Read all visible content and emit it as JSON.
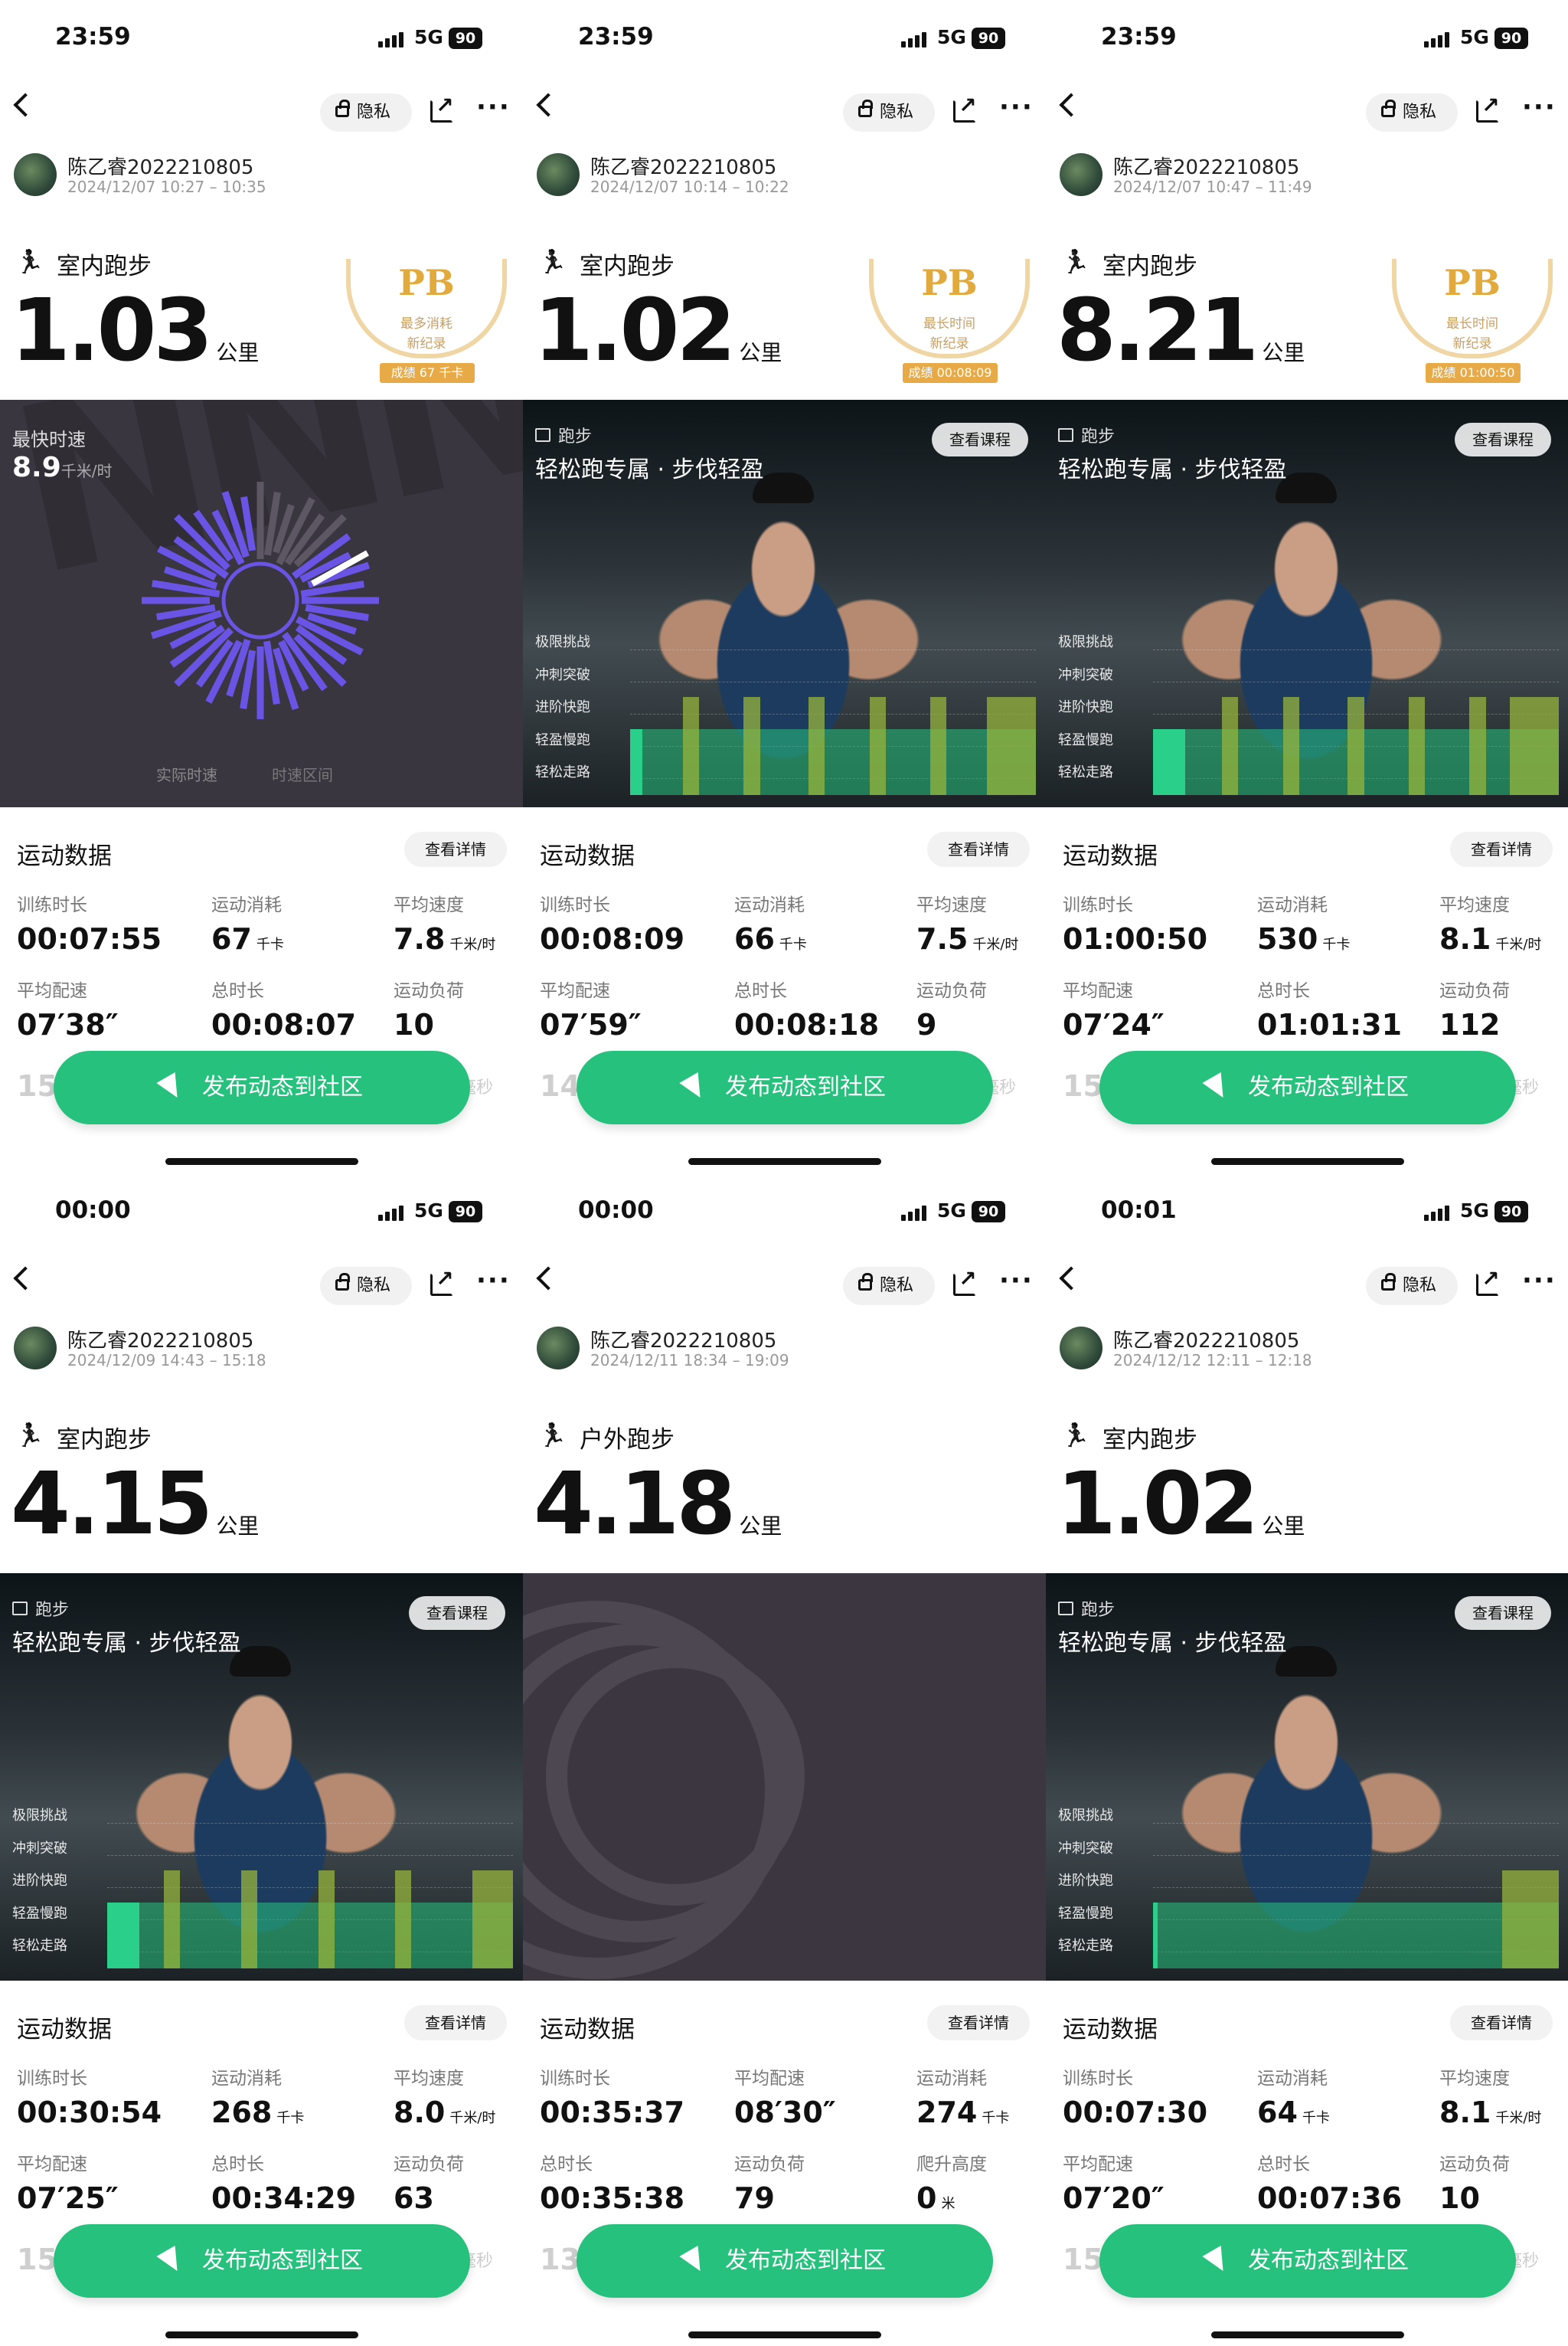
{
  "common": {
    "signal": "5G",
    "battery": "90",
    "privacy": "隐私",
    "section_title": "运动数据",
    "details": "查看详情",
    "cta": "发布动态到社区",
    "view_course": "查看课程",
    "user": "陈乙睿2022210805",
    "km": "公里",
    "kcal": "千卡",
    "kmh": "千米/时",
    "zones": [
      "极限挑战",
      "冲刺突破",
      "进阶快跑",
      "轻盈慢跑",
      "轻松走路"
    ],
    "course_tag": "跑步",
    "course_title": "轻松跑专属 · 步伐轻盈",
    "fastest_label": "最快时速",
    "fastest_value": "8.9",
    "legend_actual": "实际时速",
    "legend_range": "时速区间"
  },
  "screens": [
    {
      "time": "23:59",
      "date": "2024/12/07 10:27 – 10:35",
      "type": "室内跑步",
      "distance": "1.03",
      "banner": "speed",
      "pb": {
        "title": "PB",
        "line1": "最多消耗",
        "line2": "新纪录",
        "result": "成绩 67 千卡"
      },
      "stats": [
        [
          "训练时长",
          "00:07:55",
          ""
        ],
        [
          "运动消耗",
          "67",
          "千卡"
        ],
        [
          "平均速度",
          "7.8",
          "千米/时"
        ],
        [
          "平均配速",
          "07′38″",
          ""
        ],
        [
          "总时长",
          "00:08:07",
          ""
        ],
        [
          "运动负荷",
          "10",
          ""
        ]
      ],
      "ghost": "153",
      "ghost_right": "毫秒",
      "intervals": []
    },
    {
      "time": "23:59",
      "date": "2024/12/07 10:14 – 10:22",
      "type": "室内跑步",
      "distance": "1.02",
      "banner": "photo",
      "pb": {
        "title": "PB",
        "line1": "最长时间",
        "line2": "新纪录",
        "result": "成绩 00:08:09"
      },
      "stats": [
        [
          "训练时长",
          "00:08:09",
          ""
        ],
        [
          "运动消耗",
          "66",
          "千卡"
        ],
        [
          "平均速度",
          "7.5",
          "千米/时"
        ],
        [
          "平均配速",
          "07′59″",
          ""
        ],
        [
          "总时长",
          "00:08:18",
          ""
        ],
        [
          "运动负荷",
          "9",
          ""
        ]
      ],
      "ghost": "146",
      "ghost_right": "毫秒",
      "intervals": [
        [
          0,
          0.03
        ],
        [
          0.13,
          0.04
        ],
        [
          0.28,
          0.04
        ],
        [
          0.44,
          0.04
        ],
        [
          0.59,
          0.04
        ],
        [
          0.74,
          0.04
        ],
        [
          0.88,
          0.12
        ]
      ]
    },
    {
      "time": "23:59",
      "date": "2024/12/07 10:47 – 11:49",
      "type": "室内跑步",
      "distance": "8.21",
      "banner": "photo",
      "pb": {
        "title": "PB",
        "line1": "最长时间",
        "line2": "新纪录",
        "result": "成绩 01:00:50"
      },
      "stats": [
        [
          "训练时长",
          "01:00:50",
          ""
        ],
        [
          "运动消耗",
          "530",
          "千卡"
        ],
        [
          "平均速度",
          "8.1",
          "千米/时"
        ],
        [
          "平均配速",
          "07′24″",
          ""
        ],
        [
          "总时长",
          "01:01:31",
          ""
        ],
        [
          "运动负荷",
          "112",
          ""
        ]
      ],
      "ghost": "158",
      "ghost_right": "毫秒",
      "intervals": [
        [
          0,
          0.08
        ],
        [
          0.17,
          0.04
        ],
        [
          0.32,
          0.04
        ],
        [
          0.48,
          0.04
        ],
        [
          0.63,
          0.04
        ],
        [
          0.78,
          0.04
        ],
        [
          0.88,
          0.12
        ]
      ]
    },
    {
      "time": "00:00",
      "date": "2024/12/09 14:43 – 15:18",
      "type": "室内跑步",
      "distance": "4.15",
      "banner": "photo",
      "pb": null,
      "stats": [
        [
          "训练时长",
          "00:30:54",
          ""
        ],
        [
          "运动消耗",
          "268",
          "千卡"
        ],
        [
          "平均速度",
          "8.0",
          "千米/时"
        ],
        [
          "平均配速",
          "07′25″",
          ""
        ],
        [
          "总时长",
          "00:34:29",
          ""
        ],
        [
          "运动负荷",
          "63",
          ""
        ]
      ],
      "ghost": "157",
      "ghost_right": "毫秒",
      "intervals": [
        [
          0,
          0.08
        ],
        [
          0.14,
          0.04
        ],
        [
          0.33,
          0.04
        ],
        [
          0.52,
          0.04
        ],
        [
          0.71,
          0.04
        ],
        [
          0.9,
          0.1
        ]
      ]
    },
    {
      "time": "00:00",
      "date": "2024/12/11 18:34 – 19:09",
      "type": "户外跑步",
      "distance": "4.18",
      "banner": "track",
      "pb": null,
      "stats": [
        [
          "训练时长",
          "00:35:37",
          ""
        ],
        [
          "平均配速",
          "08′30″",
          ""
        ],
        [
          "运动消耗",
          "274",
          "千卡"
        ],
        [
          "总时长",
          "00:35:38",
          ""
        ],
        [
          "运动负荷",
          "79",
          ""
        ],
        [
          "爬升高度",
          "0",
          "米"
        ]
      ],
      "ghost": "133",
      "ghost_right": "",
      "intervals": []
    },
    {
      "time": "00:01",
      "date": "2024/12/12 12:11 – 12:18",
      "type": "室内跑步",
      "distance": "1.02",
      "banner": "photo",
      "pb": null,
      "stats": [
        [
          "训练时长",
          "00:07:30",
          ""
        ],
        [
          "运动消耗",
          "64",
          "千卡"
        ],
        [
          "平均速度",
          "8.1",
          "千米/时"
        ],
        [
          "平均配速",
          "07′20″",
          ""
        ],
        [
          "总时长",
          "00:07:36",
          ""
        ],
        [
          "运动负荷",
          "10",
          ""
        ]
      ],
      "ghost": "159",
      "ghost_right": "毫秒",
      "intervals": [
        [
          0,
          0.01
        ],
        [
          0.86,
          0.14
        ]
      ]
    }
  ]
}
